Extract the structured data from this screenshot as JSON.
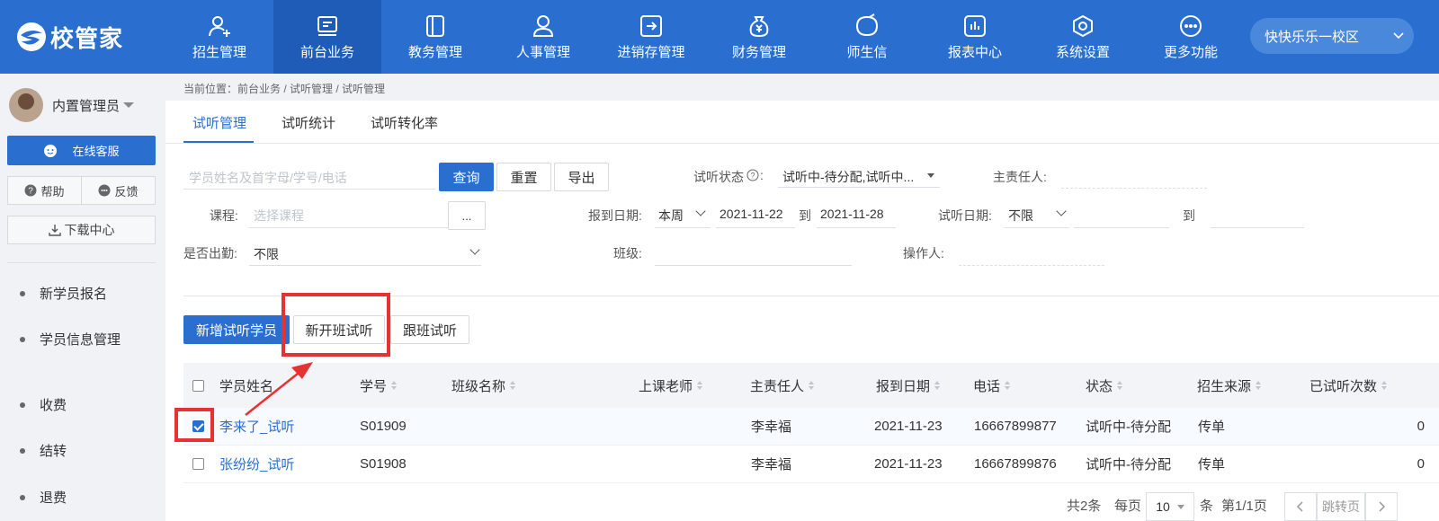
{
  "app": {
    "logo_text": "校管家"
  },
  "nav": [
    {
      "label": "招生管理",
      "icon": "person-add-icon"
    },
    {
      "label": "前台业务",
      "icon": "desk-icon"
    },
    {
      "label": "教务管理",
      "icon": "book-icon"
    },
    {
      "label": "人事管理",
      "icon": "person-icon"
    },
    {
      "label": "进销存管理",
      "icon": "inventory-icon"
    },
    {
      "label": "财务管理",
      "icon": "money-bag-icon"
    },
    {
      "label": "师生信",
      "icon": "message-icon"
    },
    {
      "label": "报表中心",
      "icon": "report-icon"
    },
    {
      "label": "系统设置",
      "icon": "settings-icon"
    },
    {
      "label": "更多功能",
      "icon": "more-icon"
    }
  ],
  "campus": "快快乐乐一校区",
  "sidebar": {
    "username": "内置管理员",
    "service": "在线客服",
    "help": "帮助",
    "feedback": "反馈",
    "download": "下载中心",
    "menu": [
      "新学员报名",
      "学员信息管理",
      "收费",
      "结转",
      "退费"
    ]
  },
  "breadcrumb": "当前位置：前台业务 / 试听管理 / 试听管理",
  "tabs": [
    "试听管理",
    "试听统计",
    "试听转化率"
  ],
  "filters": {
    "search_placeholder": "学员姓名及首字母/学号/电话",
    "query": "查询",
    "reset": "重置",
    "export": "导出",
    "status_label": "试听状态",
    "status_value": "试听中-待分配,试听中...",
    "owner_label": "主责任人:",
    "course_label": "课程:",
    "course_placeholder": "选择课程",
    "course_btn": "...",
    "report_date_label": "报到日期:",
    "report_period": "本周",
    "report_start": "2021-11-22",
    "to": "到",
    "report_end": "2021-11-28",
    "trial_date_label": "试听日期:",
    "trial_period": "不限",
    "attend_label": "是否出勤:",
    "attend_value": "不限",
    "class_label": "班级:",
    "operator_label": "操作人:"
  },
  "actions": {
    "add": "新增试听学员",
    "new_class": "新开班试听",
    "follow": "跟班试听"
  },
  "table": {
    "headers": [
      "学员姓名",
      "学号",
      "班级名称",
      "上课老师",
      "主责任人",
      "报到日期",
      "电话",
      "状态",
      "招生来源",
      "已试听次数"
    ],
    "rows": [
      {
        "checked": true,
        "name": "李来了_试听",
        "id": "S01909",
        "class": "",
        "teacher": "",
        "owner": "李幸福",
        "date": "2021-11-23",
        "phone": "16667899877",
        "status": "试听中-待分配",
        "source": "传单",
        "count": "0"
      },
      {
        "checked": false,
        "name": "张纷纷_试听",
        "id": "S01908",
        "class": "",
        "teacher": "",
        "owner": "李幸福",
        "date": "2021-11-23",
        "phone": "16667899876",
        "status": "试听中-待分配",
        "source": "传单",
        "count": "0"
      }
    ]
  },
  "pager": {
    "total": "共2条",
    "per_page": "每页",
    "size": "10",
    "unit": "条",
    "page": "第1/1页",
    "jump": "跳转页"
  },
  "annotation_color": "#e63232"
}
